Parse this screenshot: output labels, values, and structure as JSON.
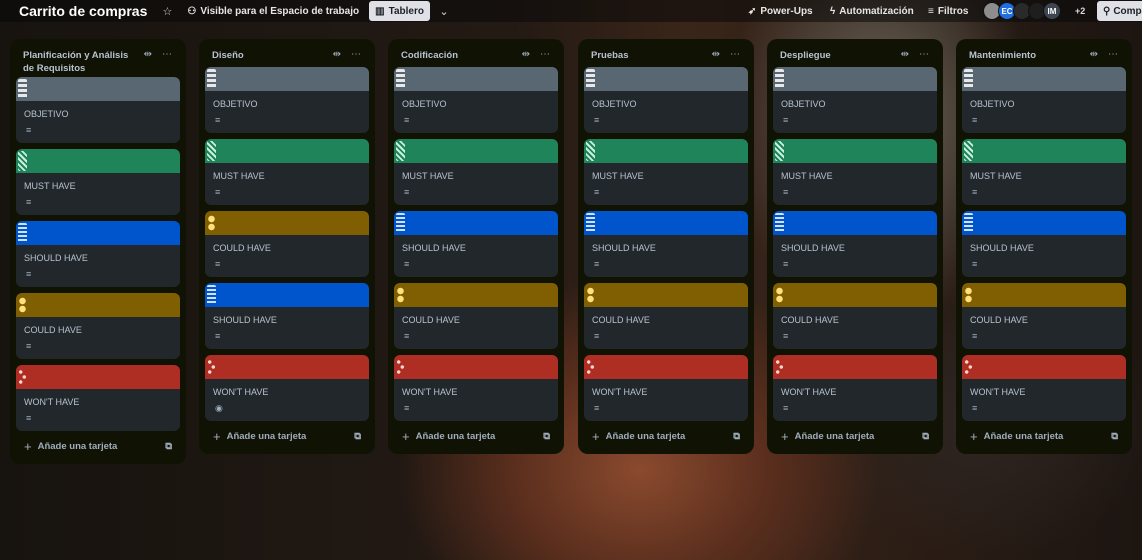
{
  "header": {
    "board_title": "Carrito de compras",
    "visibility_label": "Visible para el Espacio de trabajo",
    "view_label": "Tablero",
    "powerups_label": "Power-Ups",
    "automation_label": "Automatización",
    "filters_label": "Filtros",
    "avatars": [
      {
        "initials": "",
        "color": "#8d8d8d"
      },
      {
        "initials": "EC",
        "color": "#1f6fe0"
      },
      {
        "initials": "",
        "color": "#2a2a2a"
      },
      {
        "initials": "",
        "color": "#1e1e1e"
      },
      {
        "initials": "IM",
        "color": "#3d4650"
      }
    ],
    "extra_members": "+2",
    "share_label": "Compartir"
  },
  "colors": {
    "objetivo": "#596773",
    "must": "#1f845a",
    "should": "#0055cc",
    "could": "#7f5f01",
    "wont": "#ae2e24"
  },
  "lists": [
    {
      "title": "Planificación y Análisis de Requisitos",
      "add_label": "Añade una tarjeta",
      "cards": [
        {
          "title": "OBJETIVO",
          "cover": "objetivo",
          "badge": "description"
        },
        {
          "title": "MUST HAVE",
          "cover": "must",
          "badge": "description"
        },
        {
          "title": "SHOULD HAVE",
          "cover": "should",
          "badge": "description"
        },
        {
          "title": "COULD HAVE",
          "cover": "could",
          "badge": "description"
        },
        {
          "title": "WON'T HAVE",
          "cover": "wont",
          "badge": "description"
        }
      ]
    },
    {
      "title": "Diseño",
      "add_label": "Añade una tarjeta",
      "cards": [
        {
          "title": "OBJETIVO",
          "cover": "objetivo",
          "badge": "description"
        },
        {
          "title": "MUST HAVE",
          "cover": "must",
          "badge": "description"
        },
        {
          "title": "COULD HAVE",
          "cover": "could",
          "badge": "description"
        },
        {
          "title": "SHOULD HAVE",
          "cover": "should",
          "badge": "description"
        },
        {
          "title": "WON'T HAVE",
          "cover": "wont",
          "badge": "watch"
        }
      ]
    },
    {
      "title": "Codificación",
      "add_label": "Añade una tarjeta",
      "cards": [
        {
          "title": "OBJETIVO",
          "cover": "objetivo",
          "badge": "description"
        },
        {
          "title": "MUST HAVE",
          "cover": "must",
          "badge": "description"
        },
        {
          "title": "SHOULD HAVE",
          "cover": "should",
          "badge": "description"
        },
        {
          "title": "COULD HAVE",
          "cover": "could",
          "badge": "description"
        },
        {
          "title": "WON'T HAVE",
          "cover": "wont",
          "badge": "description"
        }
      ]
    },
    {
      "title": "Pruebas",
      "add_label": "Añade una tarjeta",
      "cards": [
        {
          "title": "OBJETIVO",
          "cover": "objetivo",
          "badge": "description"
        },
        {
          "title": "MUST HAVE",
          "cover": "must",
          "badge": "description"
        },
        {
          "title": "SHOULD HAVE",
          "cover": "should",
          "badge": "description"
        },
        {
          "title": "COULD HAVE",
          "cover": "could",
          "badge": "description"
        },
        {
          "title": "WON'T HAVE",
          "cover": "wont",
          "badge": "description"
        }
      ]
    },
    {
      "title": "Despliegue",
      "add_label": "Añade una tarjeta",
      "cards": [
        {
          "title": "OBJETIVO",
          "cover": "objetivo",
          "badge": "description"
        },
        {
          "title": "MUST HAVE",
          "cover": "must",
          "badge": "description"
        },
        {
          "title": "SHOULD HAVE",
          "cover": "should",
          "badge": "description"
        },
        {
          "title": "COULD HAVE",
          "cover": "could",
          "badge": "description"
        },
        {
          "title": "WON'T HAVE",
          "cover": "wont",
          "badge": "description"
        }
      ]
    },
    {
      "title": "Mantenimiento",
      "add_label": "Añade una tarjeta",
      "cards": [
        {
          "title": "OBJETIVO",
          "cover": "objetivo",
          "badge": "description"
        },
        {
          "title": "MUST HAVE",
          "cover": "must",
          "badge": "description"
        },
        {
          "title": "SHOULD HAVE",
          "cover": "should",
          "badge": "description"
        },
        {
          "title": "COULD HAVE",
          "cover": "could",
          "badge": "description"
        },
        {
          "title": "WON'T HAVE",
          "cover": "wont",
          "badge": "description"
        }
      ]
    }
  ]
}
